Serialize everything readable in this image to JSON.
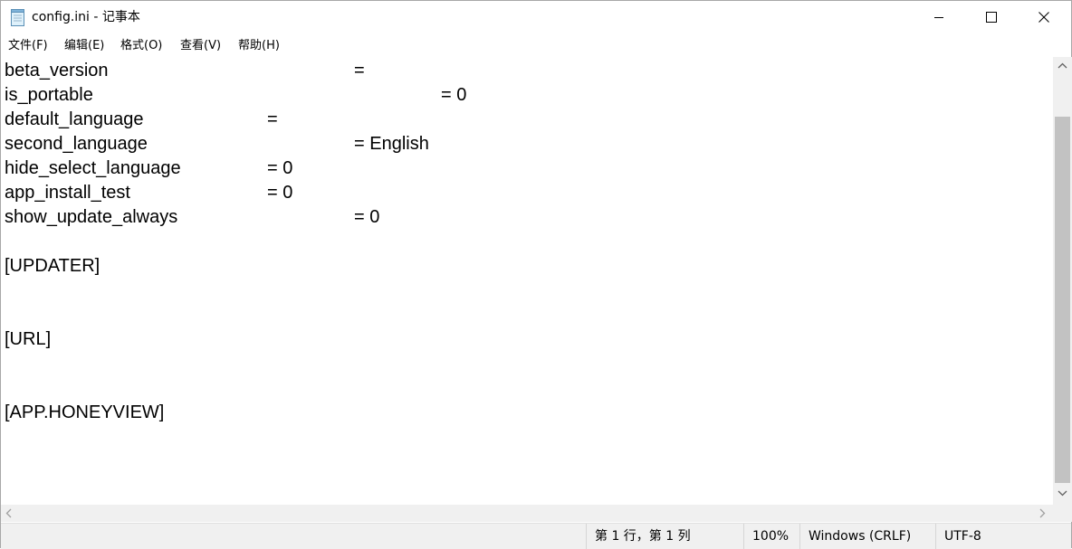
{
  "window": {
    "title": "config.ini - 记事本"
  },
  "menu": [
    "文件(F)",
    "编辑(E)",
    "格式(O)",
    "查看(V)",
    "帮助(H)"
  ],
  "lines": [
    {
      "key": "beta_version",
      "value": "="
    },
    {
      "key": "is_portable",
      "value": "= 0"
    },
    {
      "key": "default_language",
      "value": "="
    },
    {
      "key": "second_language",
      "value": "= English"
    },
    {
      "key": "hide_select_language",
      "value": "= 0"
    },
    {
      "key": "app_install_test",
      "value": "= 0"
    },
    {
      "key": "show_update_always",
      "value": "= 0"
    },
    {
      "key": "",
      "value": ""
    },
    {
      "key": "[UPDATER]",
      "value": ""
    },
    {
      "key": "",
      "value": ""
    },
    {
      "key": "",
      "value": ""
    },
    {
      "key": "[URL]",
      "value": ""
    },
    {
      "key": "",
      "value": ""
    },
    {
      "key": "",
      "value": ""
    },
    {
      "key": "[APP.HONEYVIEW]",
      "value": ""
    }
  ],
  "status": {
    "position": "第 1 行，第 1 列",
    "zoom": "100%",
    "line_ending": "Windows (CRLF)",
    "encoding": "UTF-8"
  },
  "icons": {
    "app": "notepad-icon",
    "minimize": "minimize-icon",
    "maximize": "maximize-icon",
    "close": "close-icon"
  }
}
